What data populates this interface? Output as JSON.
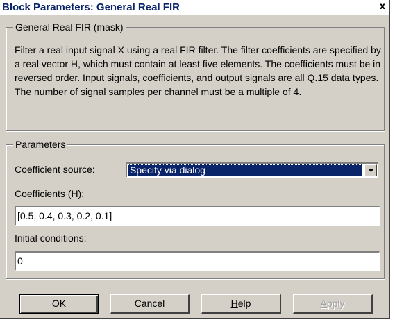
{
  "window": {
    "title": "Block Parameters: General Real FIR",
    "close_glyph": "x"
  },
  "mask_group": {
    "legend": "General Real FIR (mask)",
    "description": "Filter a real input signal X using a real FIR filter.  The filter coefficients are specified by a real vector H, which must contain at least five elements. The coefficients must be in reversed order.  Input signals, coefficients, and output signals are all Q.15 data types.  The number of signal samples per channel must be a multiple of 4."
  },
  "parameters_group": {
    "legend": "Parameters",
    "coefficient_source": {
      "label": "Coefficient source:",
      "selected": "Specify via dialog"
    },
    "coefficients": {
      "label": "Coefficients (H):",
      "value": "[0.5, 0.4, 0.3, 0.2, 0.1]"
    },
    "initial_conditions": {
      "label": "Initial conditions:",
      "value": "0"
    }
  },
  "buttons": {
    "ok": "OK",
    "cancel": "Cancel",
    "help_mnemonic": "H",
    "help_rest": "elp",
    "apply_mnemonic": "A",
    "apply_rest": "pply"
  }
}
